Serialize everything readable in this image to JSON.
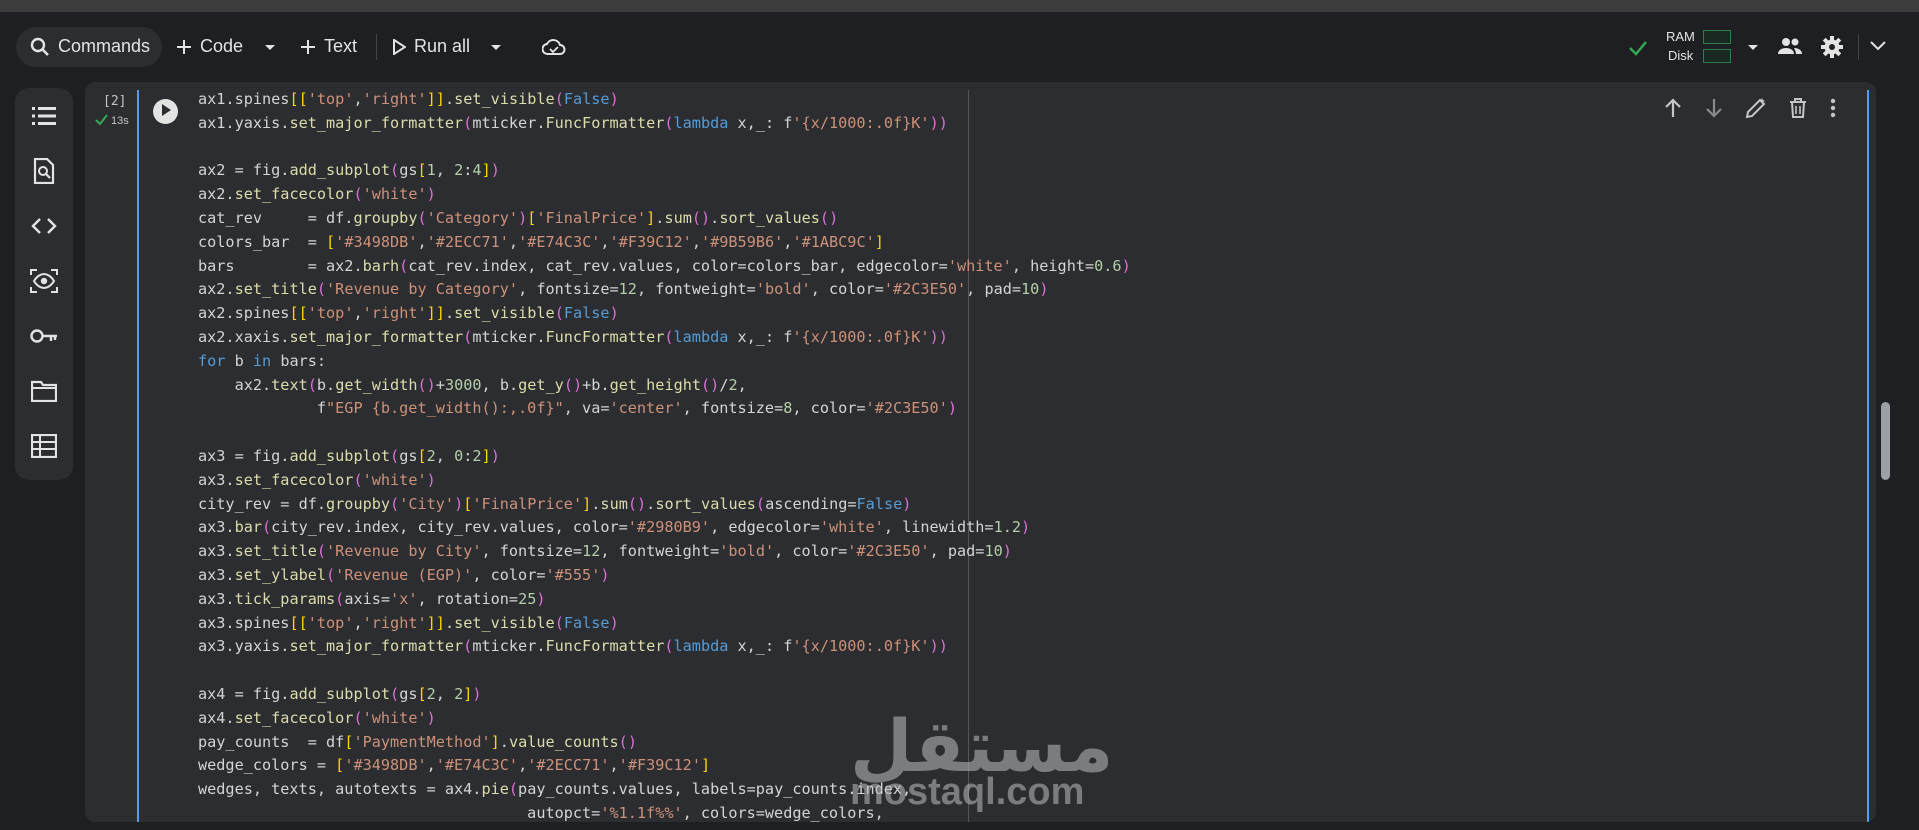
{
  "toolbar": {
    "commands_label": "Commands",
    "code_label": "Code",
    "text_label": "Text",
    "run_all_label": "Run all",
    "ram_label": "RAM",
    "disk_label": "Disk"
  },
  "cell": {
    "exec_count": "[2]",
    "exec_time": "13s"
  },
  "code_lines": [
    "ax1.spines[['top','right']].set_visible(False)",
    "ax1.yaxis.set_major_formatter(mticker.FuncFormatter(lambda x,_: f'{x/1000:.0f}K'))",
    "",
    "ax2 = fig.add_subplot(gs[1, 2:4])",
    "ax2.set_facecolor('white')",
    "cat_rev     = df.groupby('Category')['FinalPrice'].sum().sort_values()",
    "colors_bar  = ['#3498DB','#2ECC71','#E74C3C','#F39C12','#9B59B6','#1ABC9C']",
    "bars        = ax2.barh(cat_rev.index, cat_rev.values, color=colors_bar, edgecolor='white', height=0.6)",
    "ax2.set_title('Revenue by Category', fontsize=12, fontweight='bold', color='#2C3E50', pad=10)",
    "ax2.spines[['top','right']].set_visible(False)",
    "ax2.xaxis.set_major_formatter(mticker.FuncFormatter(lambda x,_: f'{x/1000:.0f}K'))",
    "for b in bars:",
    "    ax2.text(b.get_width()+3000, b.get_y()+b.get_height()/2,",
    "             f\"EGP {b.get_width():,.0f}\", va='center', fontsize=8, color='#2C3E50')",
    "",
    "ax3 = fig.add_subplot(gs[2, 0:2])",
    "ax3.set_facecolor('white')",
    "city_rev = df.groupby('City')['FinalPrice'].sum().sort_values(ascending=False)",
    "ax3.bar(city_rev.index, city_rev.values, color='#2980B9', edgecolor='white', linewidth=1.2)",
    "ax3.set_title('Revenue by City', fontsize=12, fontweight='bold', color='#2C3E50', pad=10)",
    "ax3.set_ylabel('Revenue (EGP)', color='#555')",
    "ax3.tick_params(axis='x', rotation=25)",
    "ax3.spines[['top','right']].set_visible(False)",
    "ax3.yaxis.set_major_formatter(mticker.FuncFormatter(lambda x,_: f'{x/1000:.0f}K'))",
    "",
    "ax4 = fig.add_subplot(gs[2, 2])",
    "ax4.set_facecolor('white')",
    "pay_counts  = df['PaymentMethod'].value_counts()",
    "wedge_colors = ['#3498DB','#E74C3C','#2ECC71','#F39C12']",
    "wedges, texts, autotexts = ax4.pie(pay_counts.values, labels=pay_counts.index,",
    "                                    autopct='%1.1f%%', colors=wedge_colors,"
  ],
  "watermark": {
    "arabic": "مستقل",
    "latin": "mostaql.com"
  },
  "colors": {
    "accent": "#4fa0f0",
    "ok_green": "#34a853",
    "string": "#ce9178",
    "keyword": "#569cd6",
    "number": "#b5cea8"
  },
  "icons": {
    "sidebar": [
      "toc-icon",
      "find-icon",
      "code-snippets-icon",
      "variables-icon",
      "secrets-key-icon",
      "files-folder-icon",
      "data-table-icon"
    ],
    "cell_tools": [
      "move-up-icon",
      "move-down-icon",
      "edit-pencil-icon",
      "delete-icon",
      "more-vert-icon"
    ]
  }
}
